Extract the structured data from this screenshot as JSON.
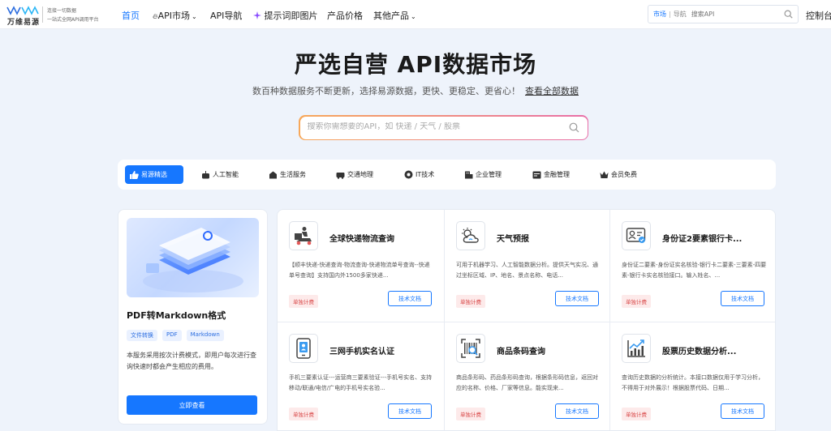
{
  "nav": {
    "brand": "万维易源",
    "slogan1": "连接一切数据",
    "slogan2": "一站式全网API调用平台",
    "items": [
      {
        "label": "首页"
      },
      {
        "label": "API市场"
      },
      {
        "label": "API导航"
      },
      {
        "label": "提示词即图片"
      },
      {
        "label": "产品价格"
      },
      {
        "label": "其他产品"
      }
    ],
    "search_scope": "市场",
    "search_scope2": "导航",
    "search_placeholder": "搜索API",
    "console": "控制台"
  },
  "hero": {
    "title": "严选自营 API数据市场",
    "subtitle": "数百种数据服务不断更新，选择易源数据，更快、更稳定、更省心！",
    "view_all": "查看全部数据",
    "search_placeholder": "搜索你需想要的API，如 快递 / 天气 / 股票"
  },
  "categories": [
    {
      "label": "易源精选",
      "icon": "thumbs-up-icon"
    },
    {
      "label": "人工智能",
      "icon": "ai-icon"
    },
    {
      "label": "生活服务",
      "icon": "life-icon"
    },
    {
      "label": "交通地理",
      "icon": "traffic-icon"
    },
    {
      "label": "IT技术",
      "icon": "it-icon"
    },
    {
      "label": "企业管理",
      "icon": "enterprise-icon"
    },
    {
      "label": "金融管理",
      "icon": "finance-icon"
    },
    {
      "label": "会员免费",
      "icon": "crown-icon"
    }
  ],
  "feature": {
    "title": "PDF转Markdown格式",
    "tags": [
      "文件转换",
      "PDF",
      "Markdown"
    ],
    "desc": "本服务采用按次计费模式，即用户每次进行查询快速时都会产生相应的费用。",
    "button": "立即查看"
  },
  "apis": [
    {
      "title": "全球快递物流查询",
      "icon": "delivery-icon",
      "desc": "【顺丰快递-快递查询-物流查询-快递物流单号查询--快递单号查询】支持国内外1500多家快递...",
      "badge": "单独计费",
      "doc": "技术文档"
    },
    {
      "title": "天气预报",
      "icon": "weather-icon",
      "desc": "可用于机器学习、人工智能数据分析。提供天气实况、通过坐标区域、IP、地名、景点名称、电话...",
      "badge": "单独计费",
      "doc": "技术文档"
    },
    {
      "title": "身份证2要素银行卡...",
      "icon": "id-card-icon",
      "desc": "身份证二要素-身份证实名核验-银行卡二要素-三要素-四要素-银行卡实名核验接口。输入姓名、...",
      "badge": "单独计费",
      "doc": "技术文档"
    },
    {
      "title": "三网手机实名认证",
      "icon": "phone-icon",
      "desc": "手机三要素认证---运营商三要素验证---手机号实名、支持移动/联通/电信/广电的手机号实名验...",
      "badge": "单独计费",
      "doc": "技术文档"
    },
    {
      "title": "商品条码查询",
      "icon": "barcode-icon",
      "desc": "商品条形码、药品条形码查询，根据条形码信息，返回对应的名称、价格、厂家等信息。能实现来...",
      "badge": "单独计费",
      "doc": "技术文档"
    },
    {
      "title": "股票历史数据分析...",
      "icon": "stock-chart-icon",
      "desc": "查询历史数据的分析统计。本接口数据仅用于学习分析，不得用于对外展示！根据股票代码、日期...",
      "badge": "单独计费",
      "doc": "技术文档"
    }
  ]
}
